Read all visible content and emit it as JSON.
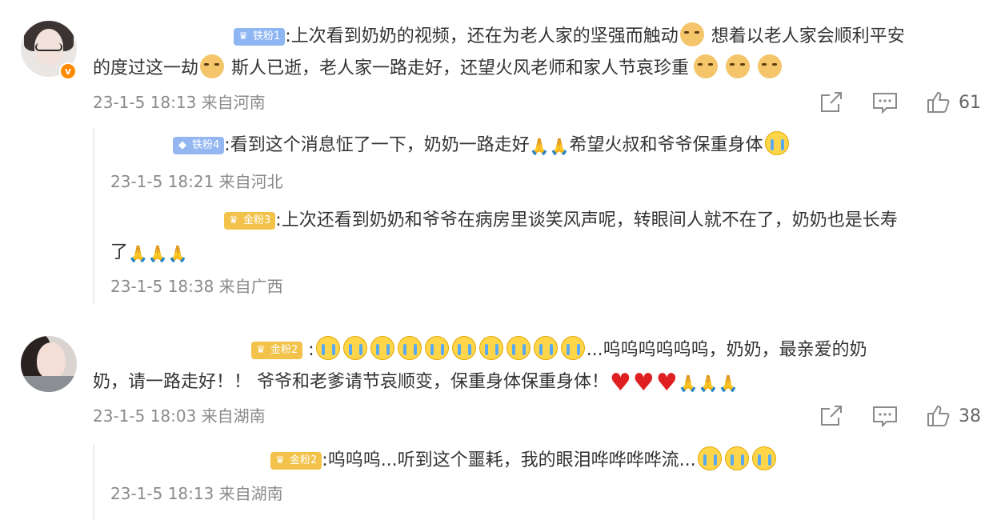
{
  "comments": [
    {
      "fan_badge": "铁粉1",
      "text_line1": ":上次看到奶奶的视频，还在为老人家的坚强而触动",
      "text_line1b": " 想着以老人家会顺利平安",
      "text_line2a": "的度过这一劫",
      "text_line2b": " 斯人已逝，老人家一路走好，还望火风老师和家人节哀珍重",
      "meta": "23-1-5 18:13 来自河南",
      "likes": "61",
      "replies": [
        {
          "fan_badge": "铁粉4",
          "text": ":看到这个消息怔了一下，奶奶一路走好",
          "text_b": "希望火叔和爷爷保重身体",
          "meta": "23-1-5 18:21 来自河北"
        },
        {
          "fan_badge": "金粉3",
          "text": ":上次还看到奶奶和爷爷在病房里谈笑风声呢，转眼间人就不在了，奶奶也是长寿",
          "text_line2": "了",
          "meta": "23-1-5 18:38 来自广西"
        }
      ]
    },
    {
      "fan_badge": "金粉2",
      "text_tail": "...呜呜呜呜呜呜，奶奶，最亲爱的奶",
      "text_line2": "奶，请一路走好！！ 爷爷和老爹请节哀顺变，保重身体保重身体！",
      "meta": "23-1-5 18:03 来自湖南",
      "likes": "38",
      "replies": [
        {
          "fan_badge": "金粉2",
          "text": ":呜呜呜...听到这个噩耗，我的眼泪哗哗哗哗流...",
          "meta": "23-1-5 18:13 来自湖南"
        }
      ]
    }
  ],
  "icons": {
    "fan_iron": "diamond-icon",
    "fan_gold": "crown-icon",
    "share": "share-icon",
    "comment": "comment-icon",
    "like": "thumbs-up-icon"
  },
  "colors": {
    "fan_iron": "#8db6f3",
    "fan_gold": "#f2c24a",
    "meta": "#8a8a8a",
    "verified": "#ff8a00"
  }
}
